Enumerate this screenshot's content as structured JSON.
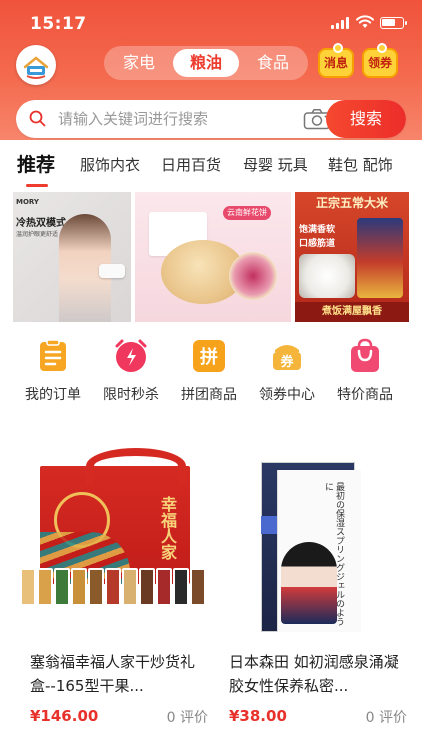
{
  "status_bar": {
    "time": "15:17"
  },
  "header": {
    "categories": [
      "家电",
      "粮油",
      "食品"
    ],
    "active_category": "粮油",
    "message_label": "消息",
    "coupon_label": "领券"
  },
  "search": {
    "placeholder": "请输入关键词进行搜索",
    "button_label": "搜索"
  },
  "tabs": [
    "推荐",
    "服饰内衣",
    "日用百货",
    "母婴 玩具",
    "鞋包 配饰"
  ],
  "banners": {
    "b1": {
      "brand": "MORY",
      "title": "冷热双模式",
      "subtitle": "温润护眼更舒适"
    },
    "b2": {
      "tag": "云南鲜花饼"
    },
    "b3": {
      "title": "正宗五常大米",
      "line1": "饱满香软",
      "line2": "口感筋道",
      "footer": "煮饭满屋飘香"
    }
  },
  "quick_actions": [
    {
      "label": "我的订单",
      "icon": "order-icon",
      "color": "#f6a623"
    },
    {
      "label": "限时秒杀",
      "icon": "alarm-clock-icon",
      "color": "#f0375d"
    },
    {
      "label": "拼团商品",
      "icon": "group-buy-icon",
      "color": "#f7a21b"
    },
    {
      "label": "领券中心",
      "icon": "coupon-center-icon",
      "color": "#f5b43a"
    },
    {
      "label": "特价商品",
      "icon": "shopping-bag-icon",
      "color": "#f04a72"
    }
  ],
  "products": [
    {
      "name": "塞翁福幸福人家干炒货礼盒--165型干果...",
      "price": "¥146.00",
      "reviews": "0 评价",
      "box_text": "幸福人家"
    },
    {
      "name": "日本森田 如初润感泉涌凝胶女性保养私密...",
      "price": "¥38.00",
      "reviews": "0 评价",
      "box_text": "最初の保湿スプリングジェルのように"
    }
  ],
  "colors": {
    "header_red": "#f0533c",
    "accent_red": "#ee3c2e",
    "price_red": "#e8312b"
  }
}
